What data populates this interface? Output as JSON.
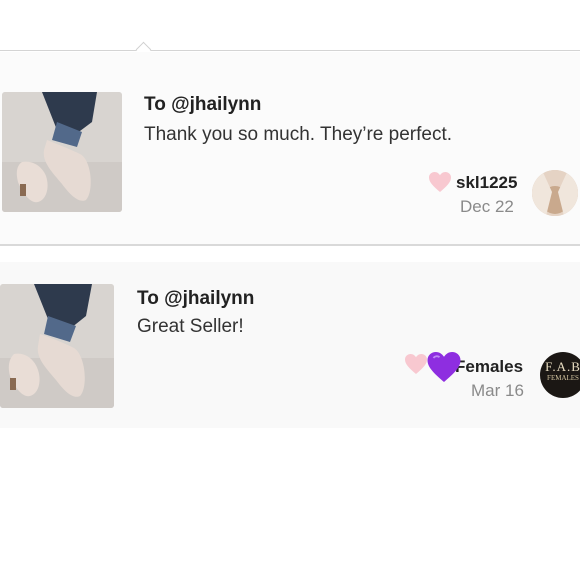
{
  "reviews": [
    {
      "to": "To @jhailynn",
      "message": "Thank you so much. They’re perfect.",
      "username": "skl1225",
      "date": "Dec 22",
      "heart_color": "#f8c8d0"
    },
    {
      "to": "To @jhailynn",
      "message": "Great Seller!",
      "username": "Females",
      "date": "Mar 16",
      "heart_color": "#f8c8d0",
      "overlay_emoji": "purple-heart",
      "overlay_color": "#8e2ee0",
      "avatar_text": "F.A.B",
      "avatar_subtext": "FEMALES"
    }
  ]
}
